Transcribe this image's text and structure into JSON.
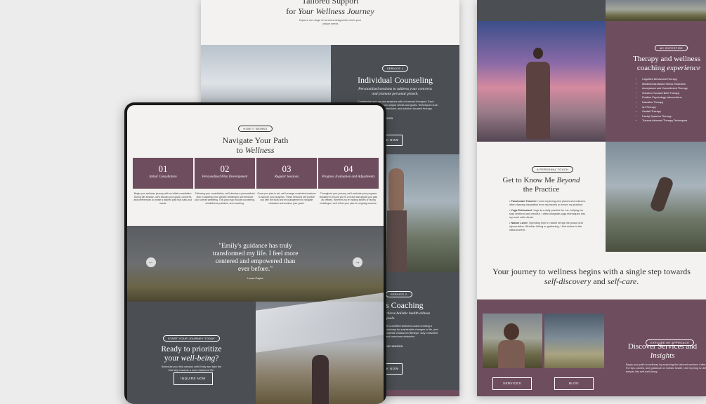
{
  "back_page": {
    "header_title_line1": "Tailored Support",
    "header_title_line2_plain": "for ",
    "header_title_line2_italic": "Your Wellness Journey",
    "header_sub": "Explore our range of services designed to meet your unique needs",
    "service1_pill": "SERVICE 1",
    "service1_title": "Individual Counseling",
    "service1_tagline": "Personalized sessions to address your concerns and promote personal growth.",
    "service1_body": "Confidential one-on-one sessions with a licensed therapist. Each session is tailored to your unique needs and goals. Techniques such as cognitive behavioral practices, and solution-focused therapy.",
    "service1_price": "per session",
    "service1_btn": "BOOK NOW",
    "service2_pill": "SERVICE 2",
    "service2_title": "s Coaching",
    "service2_tagline": "chieve holistic health ellness goals.",
    "service2_body": "ith a certified wellness coach creating a roadmap for sustainable changes in life, and cultivate a balanced lifestyle, stay motivated and overcome obstacles.",
    "service2_price": "per session",
    "service2_btn": "BOOK NOW"
  },
  "side_page": {
    "expertise_pill": "MY EXPERTISE",
    "expertise_title_plain": "Therapy and wellness coaching ",
    "expertise_title_italic": "experience",
    "expertise_items": [
      "Cognitive Behavioral Therapy",
      "Mindfulness-Based Stress Reduction",
      "Acceptance and Commitment Therapy",
      "Solution-Focused Brief Therapy",
      "Positive Psychology Interventions",
      "Narrative Therapy",
      "Art Therapy",
      "Gestalt Therapy",
      "Family Systems Therapy",
      "Trauma-Informed Therapy Techniques"
    ],
    "personal_pill": "A PERSONAL TOUCH",
    "personal_title_plain1": "Get to Know Me ",
    "personal_title_italic": "Beyond",
    "personal_title_plain2": "the Practice",
    "personal_items": [
      {
        "label": "Passionate Traveler:",
        "text": "I love exploring new places and cultures, often drawing inspiration from my travels to enrich my practice."
      },
      {
        "label": "Yoga Enthusiast:",
        "text": "Yoga is a daily practice for me, helping me stay centered and mindful. I often integrate yoga techniques into my work with clients."
      },
      {
        "label": "Nature Lover:",
        "text": "Spending time in nature brings me peace and rejuvenation. Whether hiking or gardening, I find solace in the natural world."
      }
    ],
    "journey_plain": "Your journey to wellness begins with a single step towards",
    "journey_italic1": "self-discovery",
    "journey_and": " and ",
    "journey_italic2": "self-care",
    "journey_end": ".",
    "approach_pill": "EXPLORE MY APPROACH",
    "discover_plain": "Discover Services and ",
    "discover_italic": "Insights",
    "discover_body": "Begin your path to wellness by exploring the tailored services I offer. For tips, stories, and guidance on holistic health, visit my blog to delve deeper into self-well-being.",
    "btn_services": "SERVICES",
    "btn_blog": "BLOG"
  },
  "tablet": {
    "how_pill": "HOW IT WORKS",
    "how_title_line1": "Navigate Your Path",
    "how_title_plain": "to ",
    "how_title_italic": "Wellness",
    "steps": [
      {
        "num": "01",
        "label": "Initial Consultation",
        "desc": "Begin your wellness journey with an initial consultation. During this session, we'll discuss your goals, concerns, and preferences to create a tailored plan that suits your needs."
      },
      {
        "num": "02",
        "label": "Personalized Plan Development",
        "desc": "Following your consultation, we'll develop a personalized plan to address your specific challenges and enhance your overall wellbeing. This plan may include counseling, mindfulness practices, and coaching."
      },
      {
        "num": "03",
        "label": "Regular Sessions",
        "desc": "Once your plan is set, we'll arrange consistent sessions to support your progress. These sessions will provide you with the tools and encouragement to navigate obstacles and achieve your goals."
      },
      {
        "num": "04",
        "label": "Progress Evaluation and Adjustments",
        "desc": "Throughout your journey, we'll evaluate your progress regularly to ensure you're on track and adjust your plan as needed. Whether you're making strides or facing challenges, we'll refine your plan for ongoing success."
      }
    ],
    "quote": "\"Emily's guidance has truly transformed my life. I feel more centered and empowered than ever before.\"",
    "quote_author": "Laura Paylor",
    "arrow_left": "←",
    "arrow_right": "→",
    "cta_pill": "START YOUR JOURNEY TODAY",
    "cta_title_plain": "Ready to prioritize your ",
    "cta_title_italic": "well-being",
    "cta_title_end": "?",
    "cta_body": "Schedule your first session with Emily and take the first step towards a more balanced life.",
    "cta_btn": "INQUIRE NOW"
  },
  "colors": {
    "plum": "#6e4d5e",
    "slate": "#4b4f53",
    "cream": "#f3f2f0"
  }
}
